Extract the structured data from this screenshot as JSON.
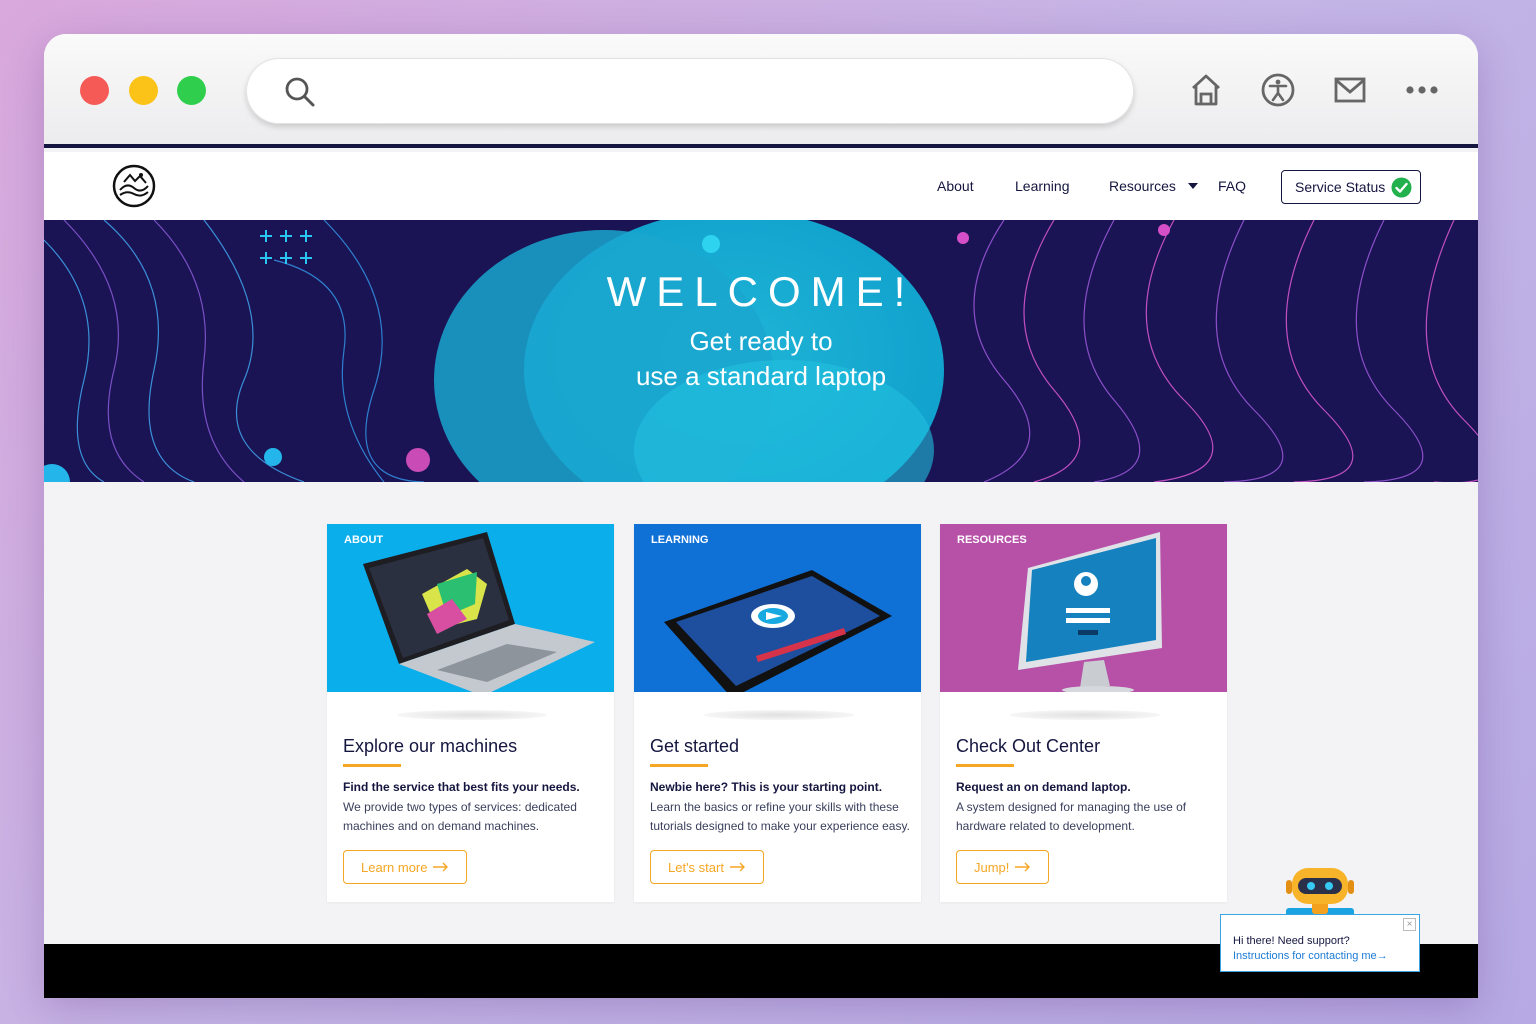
{
  "browser": {
    "url": "",
    "icons": [
      "search-icon",
      "home-icon",
      "accessibility-icon",
      "mail-icon",
      "more-icon"
    ]
  },
  "nav": {
    "links": [
      "About",
      "Learning",
      "Resources",
      "FAQ"
    ],
    "status_button": "Service Status"
  },
  "hero": {
    "title": "WELCOME!",
    "subtitle_line1": "Get ready to",
    "subtitle_line2": "use a standard laptop"
  },
  "cards": [
    {
      "tag": "ABOUT",
      "title": "Explore our machines",
      "lead": "Find the service that best fits your needs.",
      "desc": "We provide two types of services: dedicated machines and on demand machines.",
      "button": "Learn more",
      "color": "#0aaeea"
    },
    {
      "tag": "LEARNING",
      "title": "Get started",
      "lead": "Newbie here? This is your starting point.",
      "desc": "Learn the basics or refine your skills with these tutorials designed to make your experience easy.",
      "button": "Let's start",
      "color": "#0f70d6"
    },
    {
      "tag": "RESOURCES",
      "title": "Check Out Center",
      "lead": "Request an on demand laptop.",
      "desc": "A system designed for managing the use of hardware related to development.",
      "button": "Jump!",
      "color": "#b751a8"
    }
  ],
  "chat": {
    "greeting": "Hi there! Need support?",
    "link": "Instructions for contacting me"
  },
  "colors": {
    "navy": "#14163f",
    "accent": "#f5a623",
    "success": "#22b14c"
  }
}
